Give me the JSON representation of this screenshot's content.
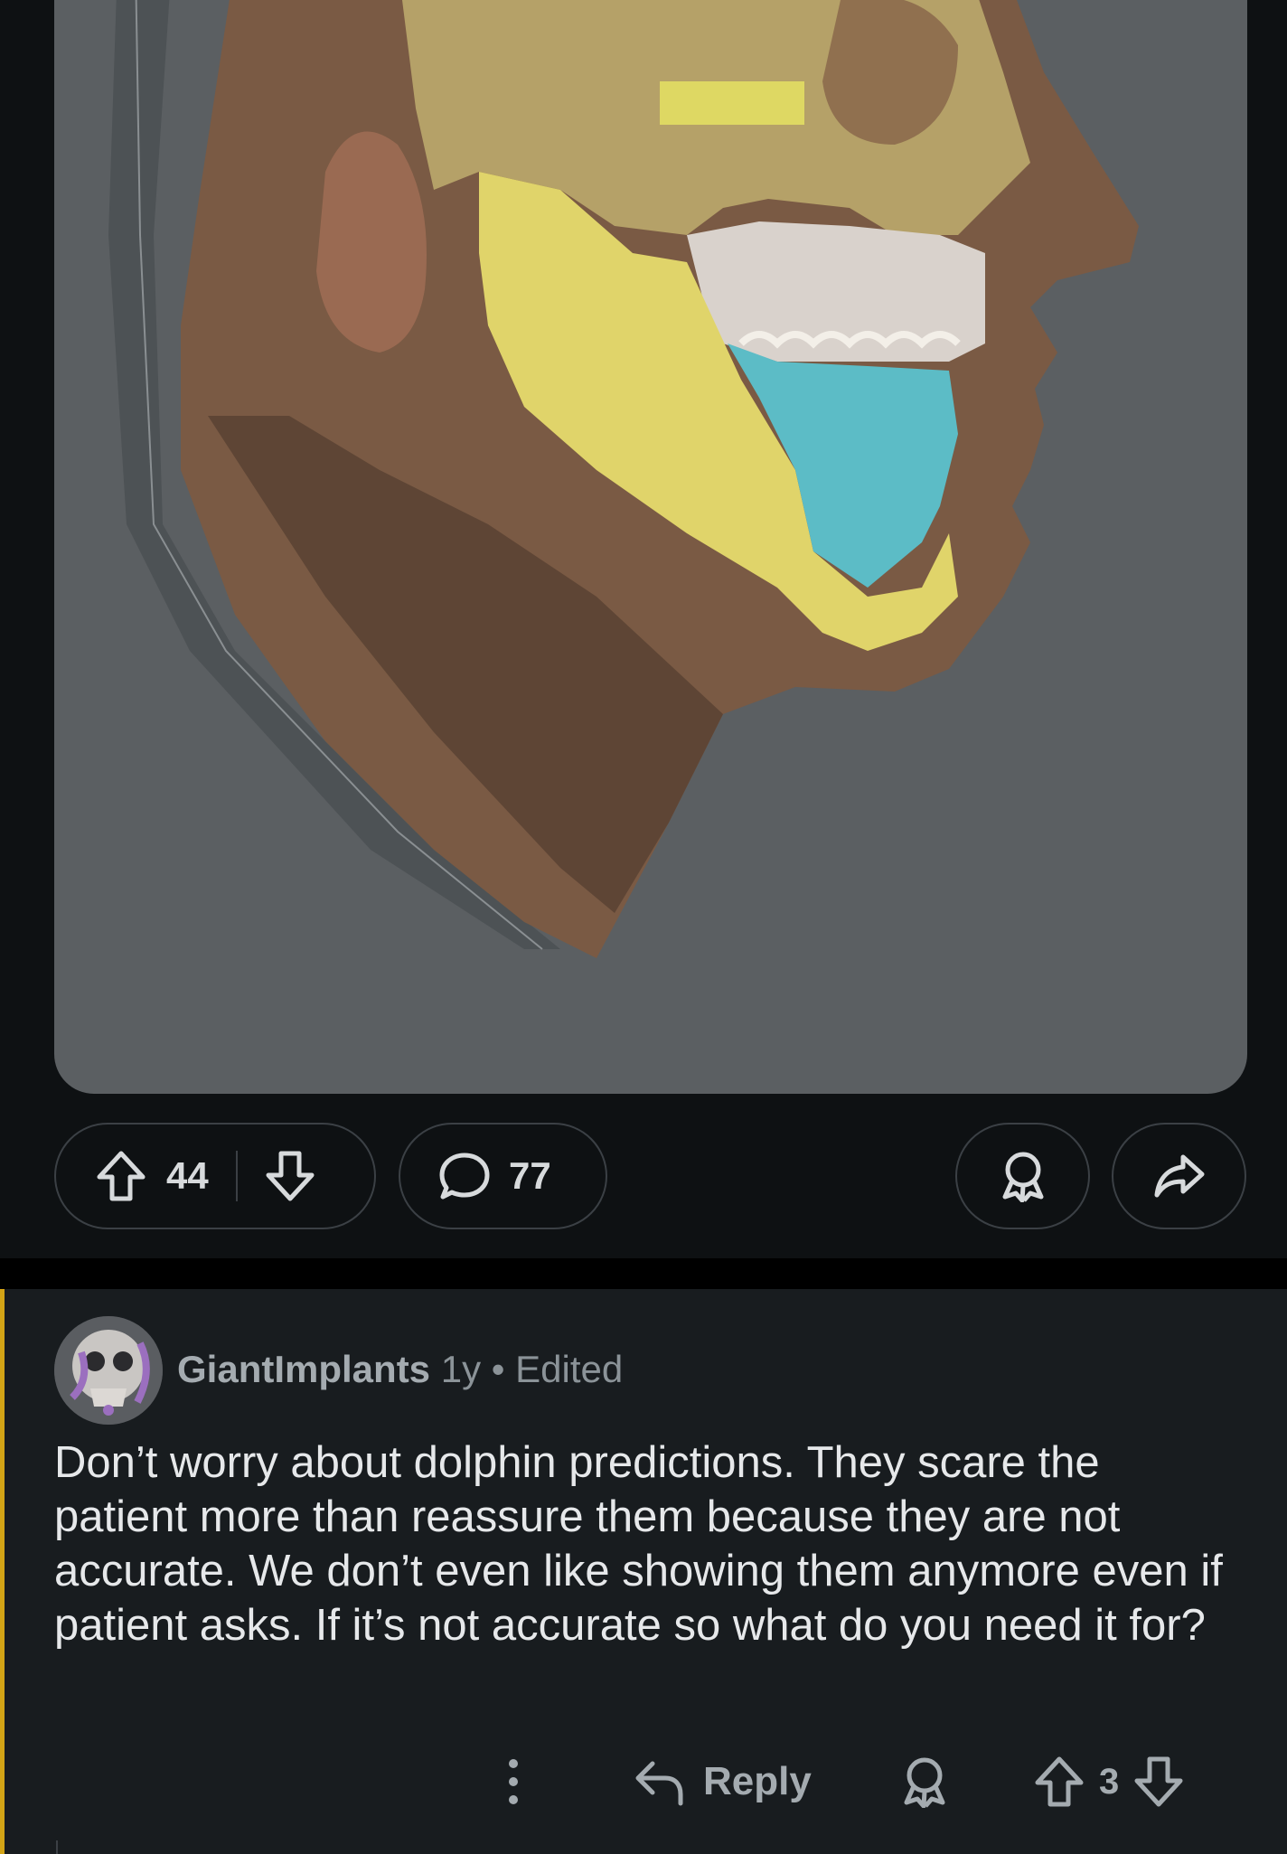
{
  "post": {
    "image_alt": "3D scan of head profile with skull overlay",
    "upvote_count": "44",
    "comment_count": "77",
    "icons": {
      "upvote": "arrow-up-icon",
      "downvote": "arrow-down-icon",
      "comments": "speech-bubble-icon",
      "award": "award-icon",
      "share": "share-arrow-icon"
    }
  },
  "comment": {
    "author": "GiantImplants",
    "age": "1y",
    "separator": "•",
    "edited": "Edited",
    "body": "Don’t worry about dolphin predictions. They scare the patient more than reassure them because they are not accurate. We don’t even like showing them anymore even if patient asks. If it’s not accurate so what do you need it for?",
    "actions": {
      "reply_label": "Reply",
      "score": "3"
    }
  },
  "colors": {
    "background": "#0e1113",
    "comment_background": "#181c1f",
    "thread_line": "#d3a416",
    "pill_border": "#3b4045",
    "image_background": "#5b5f62"
  }
}
